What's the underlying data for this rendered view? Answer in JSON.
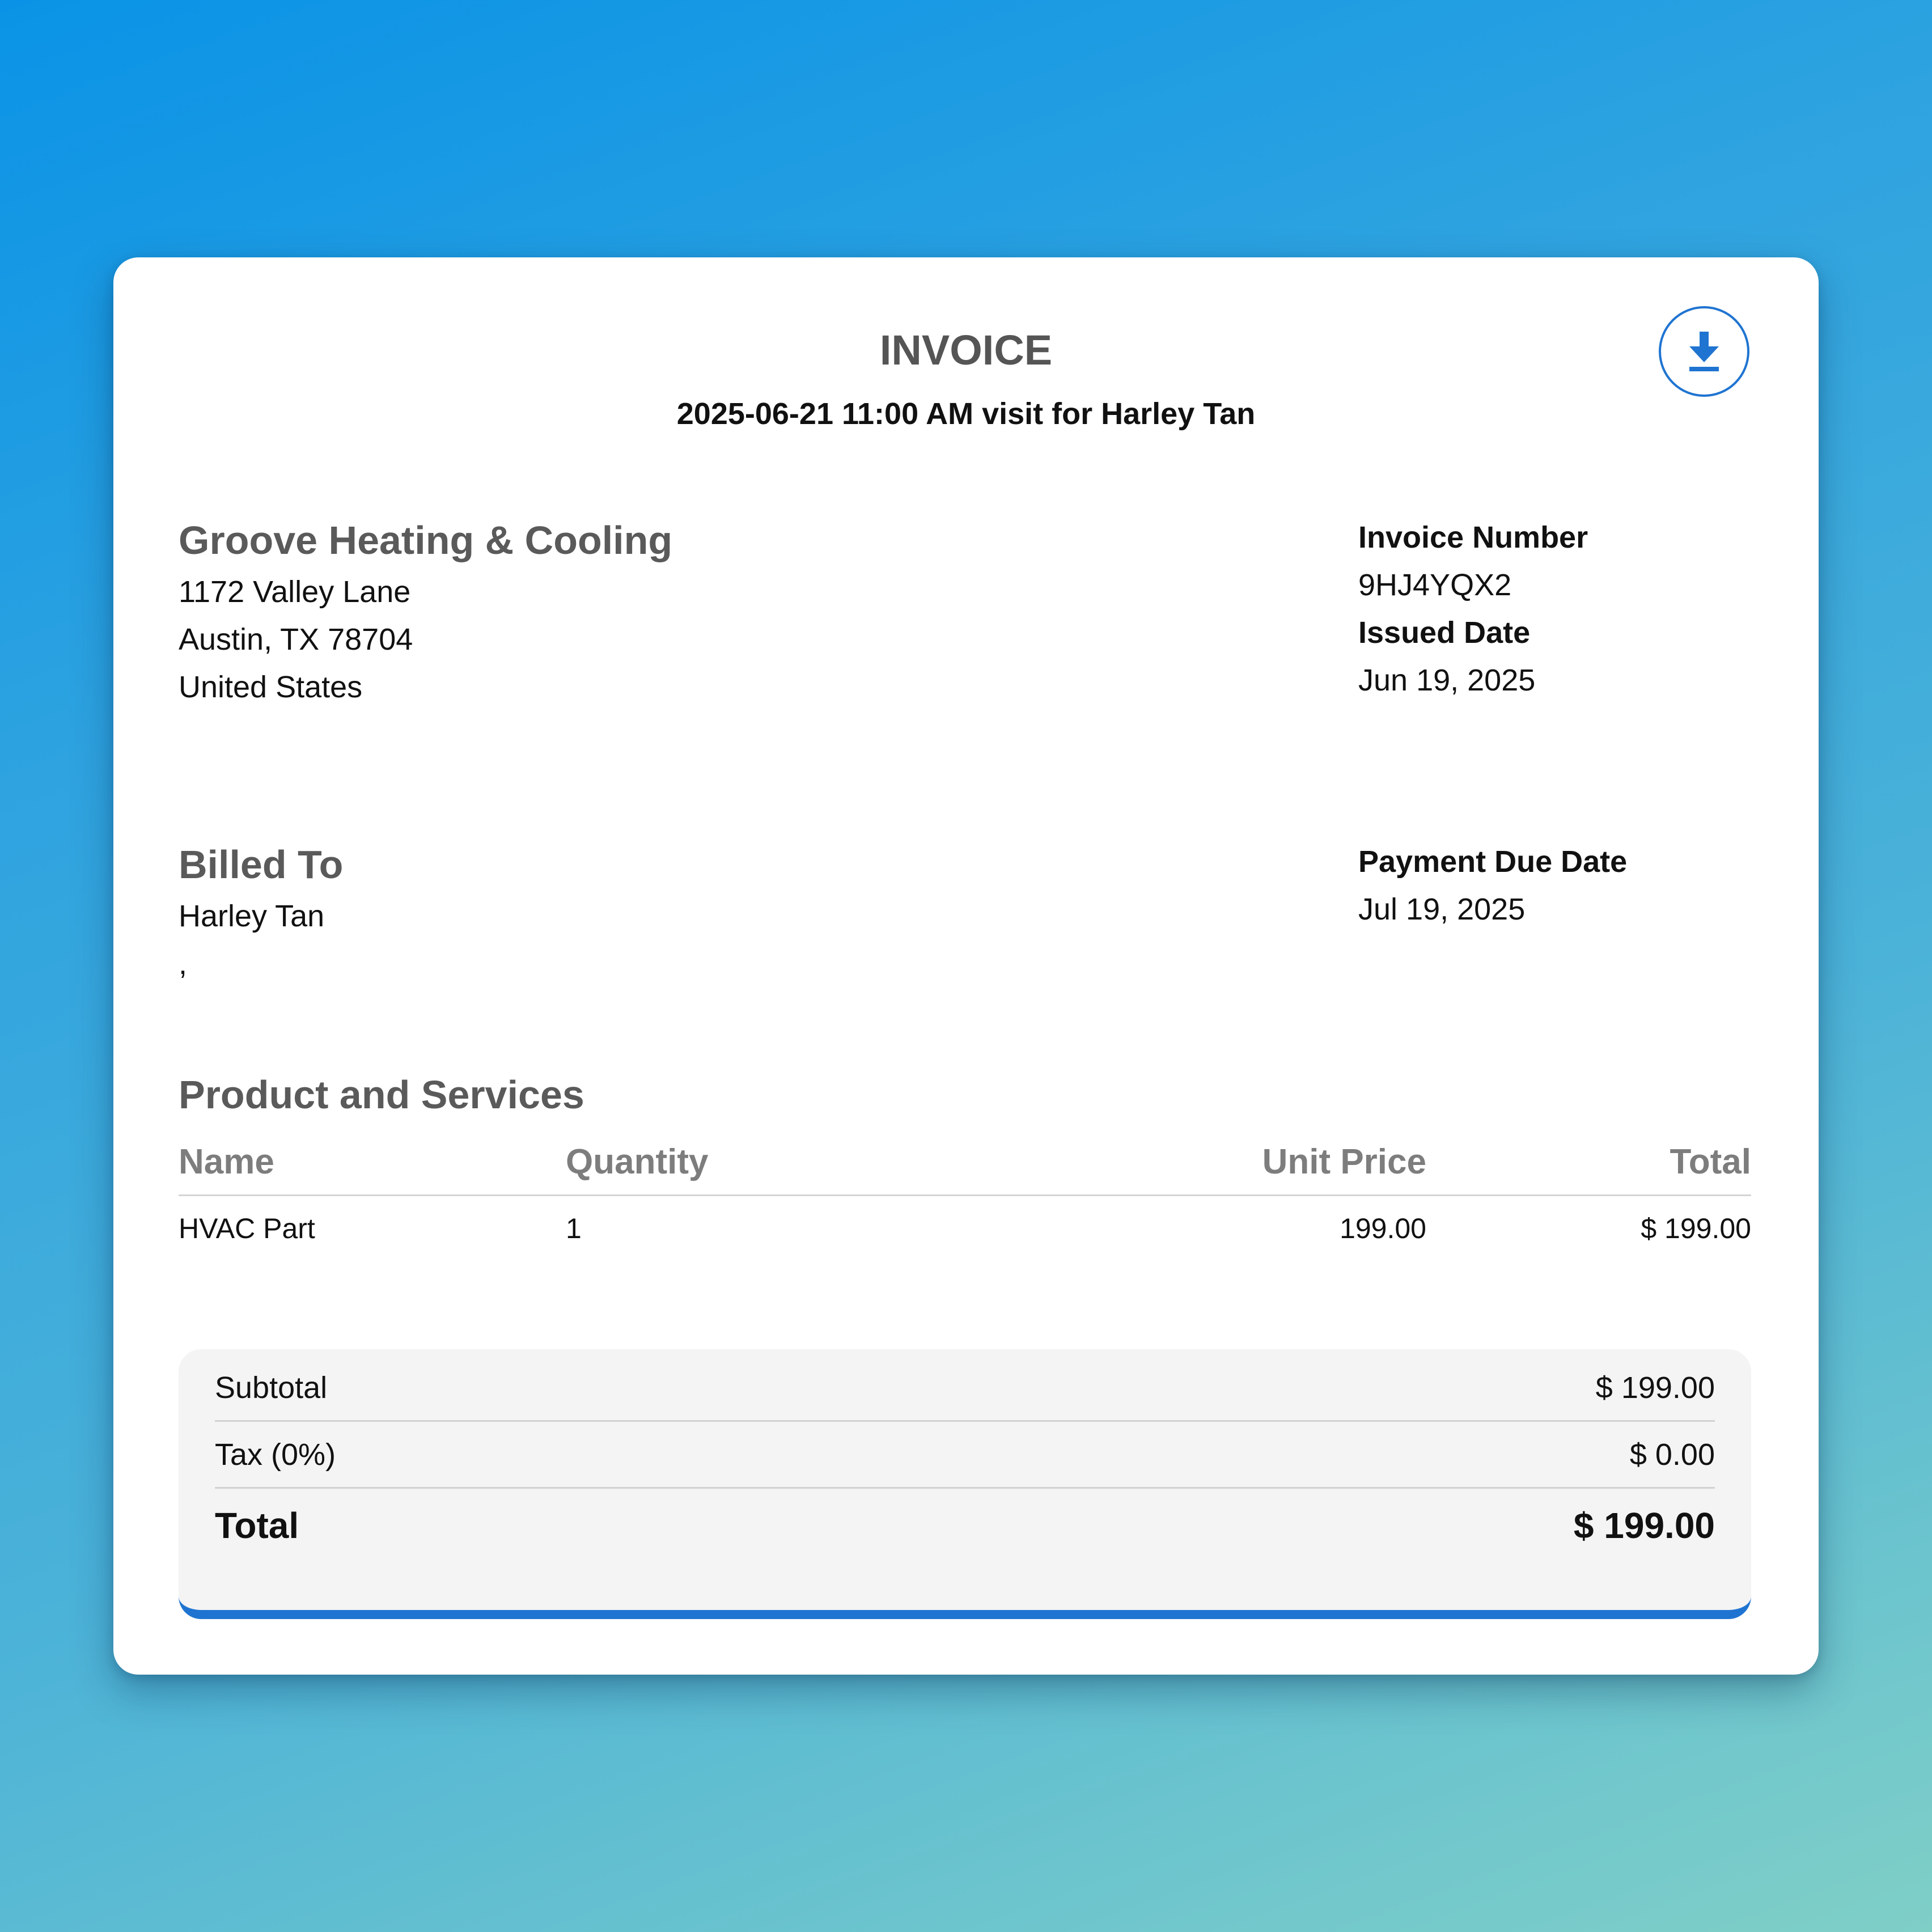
{
  "invoice": {
    "title": "INVOICE",
    "subtitle": "2025-06-21 11:00 AM visit for Harley Tan",
    "download_icon": "download-icon"
  },
  "company": {
    "name": "Groove Heating & Cooling",
    "address_line1": "1172 Valley Lane",
    "address_line2": "Austin, TX 78704",
    "country": "United States"
  },
  "meta": {
    "invoice_number_label": "Invoice Number",
    "invoice_number": "9HJ4YQX2",
    "issued_date_label": "Issued Date",
    "issued_date": "Jun 19, 2025",
    "due_date_label": "Payment Due Date",
    "due_date": "Jul 19, 2025"
  },
  "billed_to": {
    "heading": "Billed To",
    "name": "Harley Tan",
    "address": ","
  },
  "products": {
    "heading": "Product and Services",
    "columns": [
      "Name",
      "Quantity",
      "Unit Price",
      "Total"
    ],
    "rows": [
      {
        "name": "HVAC Part",
        "quantity": "1",
        "unit_price": "199.00",
        "total": "$ 199.00"
      }
    ]
  },
  "totals": {
    "subtotal_label": "Subtotal",
    "subtotal": "$ 199.00",
    "tax_label": "Tax (0%)",
    "tax": "$ 0.00",
    "total_label": "Total",
    "total": "$ 199.00"
  },
  "colors": {
    "accent": "#1f74d1",
    "heading_gray": "#5a5a5a",
    "column_gray": "#7d7d7d",
    "totals_bg": "#f4f4f4"
  }
}
